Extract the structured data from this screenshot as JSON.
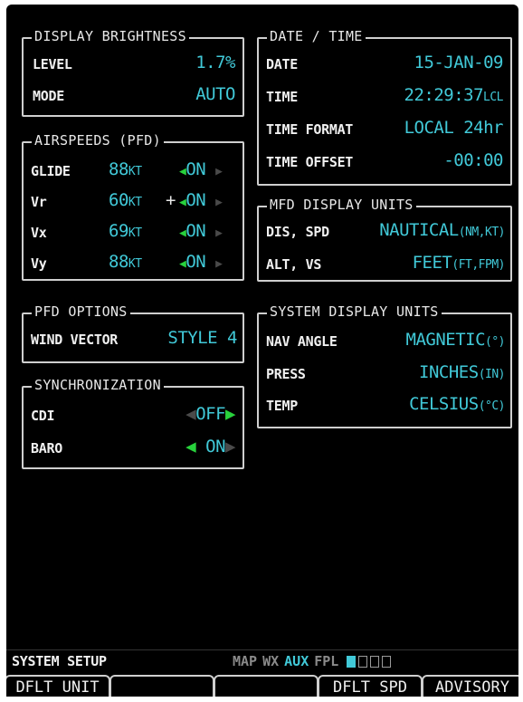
{
  "display_brightness": {
    "title": "DISPLAY BRIGHTNESS",
    "level_label": "LEVEL",
    "level_value": "1.7%",
    "mode_label": "MODE",
    "mode_value": "AUTO"
  },
  "date_time": {
    "title": "DATE / TIME",
    "date_label": "DATE",
    "date_value": "15-JAN-09",
    "time_label": "TIME",
    "time_value": "22:29:37",
    "time_suffix": "LCL",
    "format_label": "TIME FORMAT",
    "format_value": "LOCAL 24hr",
    "offset_label": "TIME OFFSET",
    "offset_value": "-00:00"
  },
  "airspeeds": {
    "title": "AIRSPEEDS (PFD)",
    "rows": [
      {
        "label": "GLIDE",
        "value": "88",
        "unit": "KT",
        "plus": "",
        "state": "ON"
      },
      {
        "label": "Vr",
        "value": "60",
        "unit": "KT",
        "plus": "+",
        "state": "ON"
      },
      {
        "label": "Vx",
        "value": "69",
        "unit": "KT",
        "plus": "",
        "state": "ON"
      },
      {
        "label": "Vy",
        "value": "88",
        "unit": "KT",
        "plus": "",
        "state": "ON"
      }
    ]
  },
  "mfd_units": {
    "title": "MFD DISPLAY UNITS",
    "dis_label": "DIS, SPD",
    "dis_value": "NAUTICAL",
    "dis_unit": "(NM,KT)",
    "alt_label": "ALT, VS",
    "alt_value": "FEET",
    "alt_unit": "(FT,FPM)"
  },
  "pfd_options": {
    "title": "PFD OPTIONS",
    "wind_label": "WIND VECTOR",
    "wind_value": "STYLE 4"
  },
  "system_units": {
    "title": "SYSTEM DISPLAY UNITS",
    "nav_label": "NAV ANGLE",
    "nav_value": "MAGNETIC",
    "nav_unit": "(°)",
    "press_label": "PRESS",
    "press_value": "INCHES",
    "press_unit": "(IN)",
    "temp_label": "TEMP",
    "temp_value": "CELSIUS",
    "temp_unit": "(°C)"
  },
  "sync": {
    "title": "SYNCHRONIZATION",
    "cdi_label": "CDI",
    "cdi_value": "OFF",
    "baro_label": "BARO",
    "baro_value": "ON"
  },
  "status_bar": {
    "page_name": "SYSTEM SETUP",
    "groups": [
      "MAP",
      "WX",
      "AUX",
      "FPL"
    ],
    "active_group": "AUX"
  },
  "softkeys": [
    "DFLT UNIT",
    "",
    "",
    "DFLT SPD",
    "ADVISORY"
  ],
  "colors": {
    "accent": "#41c9d8",
    "arrow_active": "#28d23c",
    "background": "#000000"
  }
}
